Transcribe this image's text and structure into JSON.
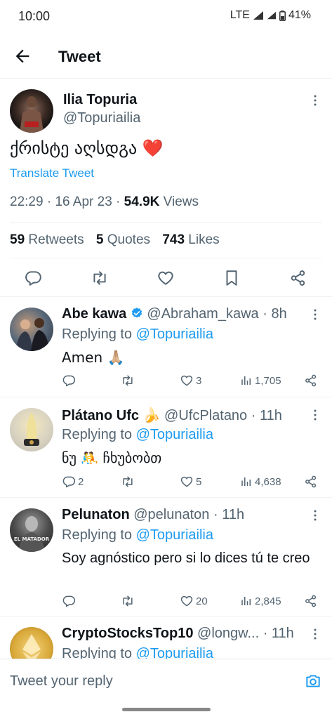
{
  "status_bar": {
    "time": "10:00",
    "network": "LTE",
    "battery": "41%"
  },
  "header": {
    "title": "Tweet"
  },
  "tweet": {
    "author_name": "Ilia Topuria",
    "author_handle": "@Topuriailia",
    "text": "ქრისტე აღსდგა ❤️",
    "translate_label": "Translate Tweet",
    "time": "22:29",
    "date": "16 Apr 23",
    "views_count": "54.9K",
    "views_label": "Views",
    "retweets_count": "59",
    "retweets_label": "Retweets",
    "quotes_count": "5",
    "quotes_label": "Quotes",
    "likes_count": "743",
    "likes_label": "Likes"
  },
  "replies": [
    {
      "name": "Abe kawa",
      "verified": true,
      "handle": "@Abraham_kawa",
      "age": "8h",
      "replying_prefix": "Replying to",
      "replying_to": "@Topuriailia",
      "text": "Amen 🙏🏼",
      "comments": "",
      "retweets": "",
      "likes": "3",
      "views": "1,705"
    },
    {
      "name": "Plátano Ufc 🍌",
      "verified": false,
      "handle": "@UfcPlatano",
      "age": "11h",
      "replying_prefix": "Replying to",
      "replying_to": "@Topuriailia",
      "text": "ნუ 🤼 ჩხუბობთ",
      "comments": "2",
      "retweets": "",
      "likes": "5",
      "views": "4,638"
    },
    {
      "name": "Pelunaton",
      "verified": false,
      "handle": "@pelunaton",
      "age": "11h",
      "replying_prefix": "Replying to",
      "replying_to": "@Topuriailia",
      "text": "Soy agnóstico pero si lo dices tú te creo",
      "comments": "",
      "retweets": "",
      "likes": "20",
      "views": "2,845"
    },
    {
      "name": "CryptoStocksTop10",
      "verified": false,
      "handle": "@longw...",
      "age": "11h",
      "replying_prefix": "Replying to",
      "replying_to": "@Topuriailia"
    }
  ],
  "reply_bar": {
    "placeholder": "Tweet your reply"
  },
  "avatar_text": {
    "pelunaton": "EL MATADOR"
  },
  "colors": {
    "accent": "#1d9bf0",
    "text": "#0f1419",
    "secondary": "#536471",
    "divider": "#eff3f4"
  }
}
